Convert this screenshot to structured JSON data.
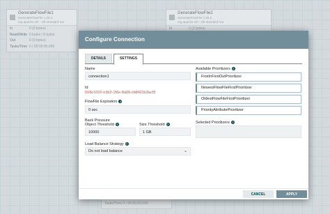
{
  "canvas": {
    "processors": [
      {
        "name": "GenerateFlowFile1",
        "version": "GenerateFlowFile 1.25.0",
        "bundle": "org.apache.nifi - nifi-standard-nar",
        "stats": [
          {
            "key": "In",
            "value": "0 (0 bytes)"
          },
          {
            "key": "Read/Write",
            "value": "0 bytes / 0 bytes"
          },
          {
            "key": "Out",
            "value": "0 (0 bytes)"
          },
          {
            "key": "Tasks/Time",
            "value": "0 / 00:00:00.000"
          }
        ]
      },
      {
        "name": "GenerateFlowFile2",
        "version": "GenerateFlowFile 1.25.0",
        "bundle": "org.apache.nifi - nifi-standard-nar",
        "stats": [
          {
            "key": "In",
            "value": "0 (0 bytes)"
          },
          {
            "key": "Read/Write",
            "value": "0 bytes / 0 bytes"
          },
          {
            "key": "Out",
            "value": "0 (0 bytes)"
          }
        ]
      }
    ],
    "bottom_text": "Tasks/Time   0 / 00:00:00.000"
  },
  "dialog": {
    "title": "Configure Connection",
    "tabs": [
      {
        "label": "DETAILS",
        "active": false
      },
      {
        "label": "SETTINGS",
        "active": true
      }
    ],
    "name_label": "Name",
    "name_value": "connection1",
    "id_label": "Id",
    "id_value": "018e1002-e3b2-1f6e-8a06-cb8421b3acf5",
    "expiration_label": "FlowFile Expiration",
    "expiration_value": "0 sec",
    "backpressure_label": "Back Pressure",
    "object_threshold_label": "Object Threshold",
    "object_threshold_value": "10000",
    "size_threshold_label": "Size Threshold",
    "size_threshold_value": "1 GB",
    "lb_label": "Load Balance Strategy",
    "lb_value": "Do not load balance",
    "available_label": "Available Prioritizers",
    "prioritizers": [
      "FirstInFirstOutPrioritizer",
      "NewestFlowFileFirstPrioritizer",
      "OldestFlowFileFirstPrioritizer",
      "PriorityAttributePrioritizer"
    ],
    "selected_label": "Selected Prioritizers",
    "cancel_label": "CANCEL",
    "apply_label": "APPLY",
    "help_glyph": "?",
    "caret_glyph": "⌄"
  },
  "colors": {
    "header": "#728e9b",
    "id_text": "#ba554a",
    "help_icon": "#004849"
  }
}
